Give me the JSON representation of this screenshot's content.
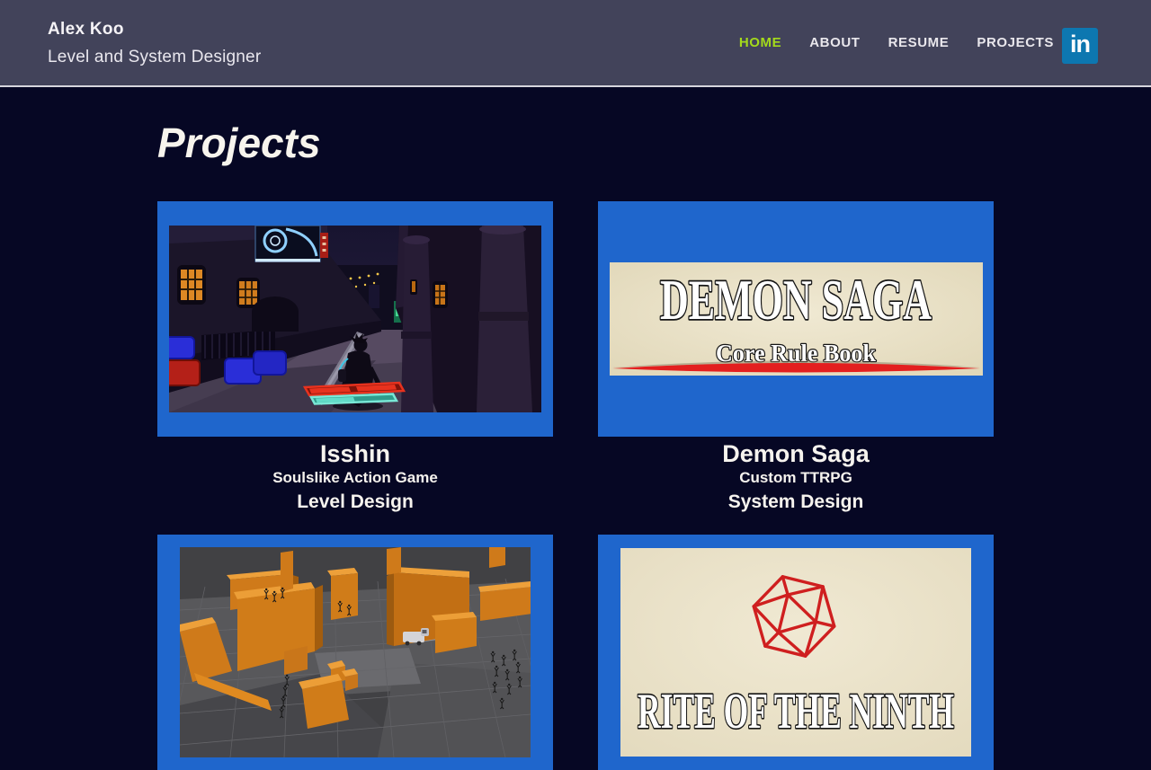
{
  "colors": {
    "page_bg": "#060724",
    "header_bg": "#42435a",
    "header_divider": "#d6d5dc",
    "nav_active_green": "#a4da1b",
    "nav_link": "#e9e7ec",
    "card_blue": "#1f66cc",
    "linkedin_blue": "#0d77b0",
    "text_light": "#f6f3ee",
    "parchment": "#ece5cd",
    "banner_red": "#e31f1f",
    "blockout_orange": "#d07c19"
  },
  "header": {
    "name": "Alex Koo",
    "subtitle": "Level and System Designer",
    "nav": [
      {
        "label": "HOME",
        "active": true
      },
      {
        "label": "ABOUT",
        "active": false
      },
      {
        "label": "RESUME",
        "active": false
      },
      {
        "label": "PROJECTS",
        "active": false
      }
    ],
    "linkedin_label": "in"
  },
  "main": {
    "title": "Projects"
  },
  "projects": [
    {
      "title": "Isshin",
      "subtitle": "Soulslike Action Game",
      "role": "Level Design",
      "image": "soulslike-night-street-gameplay-screenshot"
    },
    {
      "title": "Demon Saga",
      "subtitle": "Custom TTRPG",
      "role": "System Design",
      "banner_title": "DEMON SAGA",
      "banner_subtitle": "Core Rule Book"
    },
    {
      "image": "orange-blockout-level-editor-screenshot"
    },
    {
      "banner_title": "RITE OF THE NINTH",
      "image": "red-d20-parchment-cover"
    }
  ]
}
